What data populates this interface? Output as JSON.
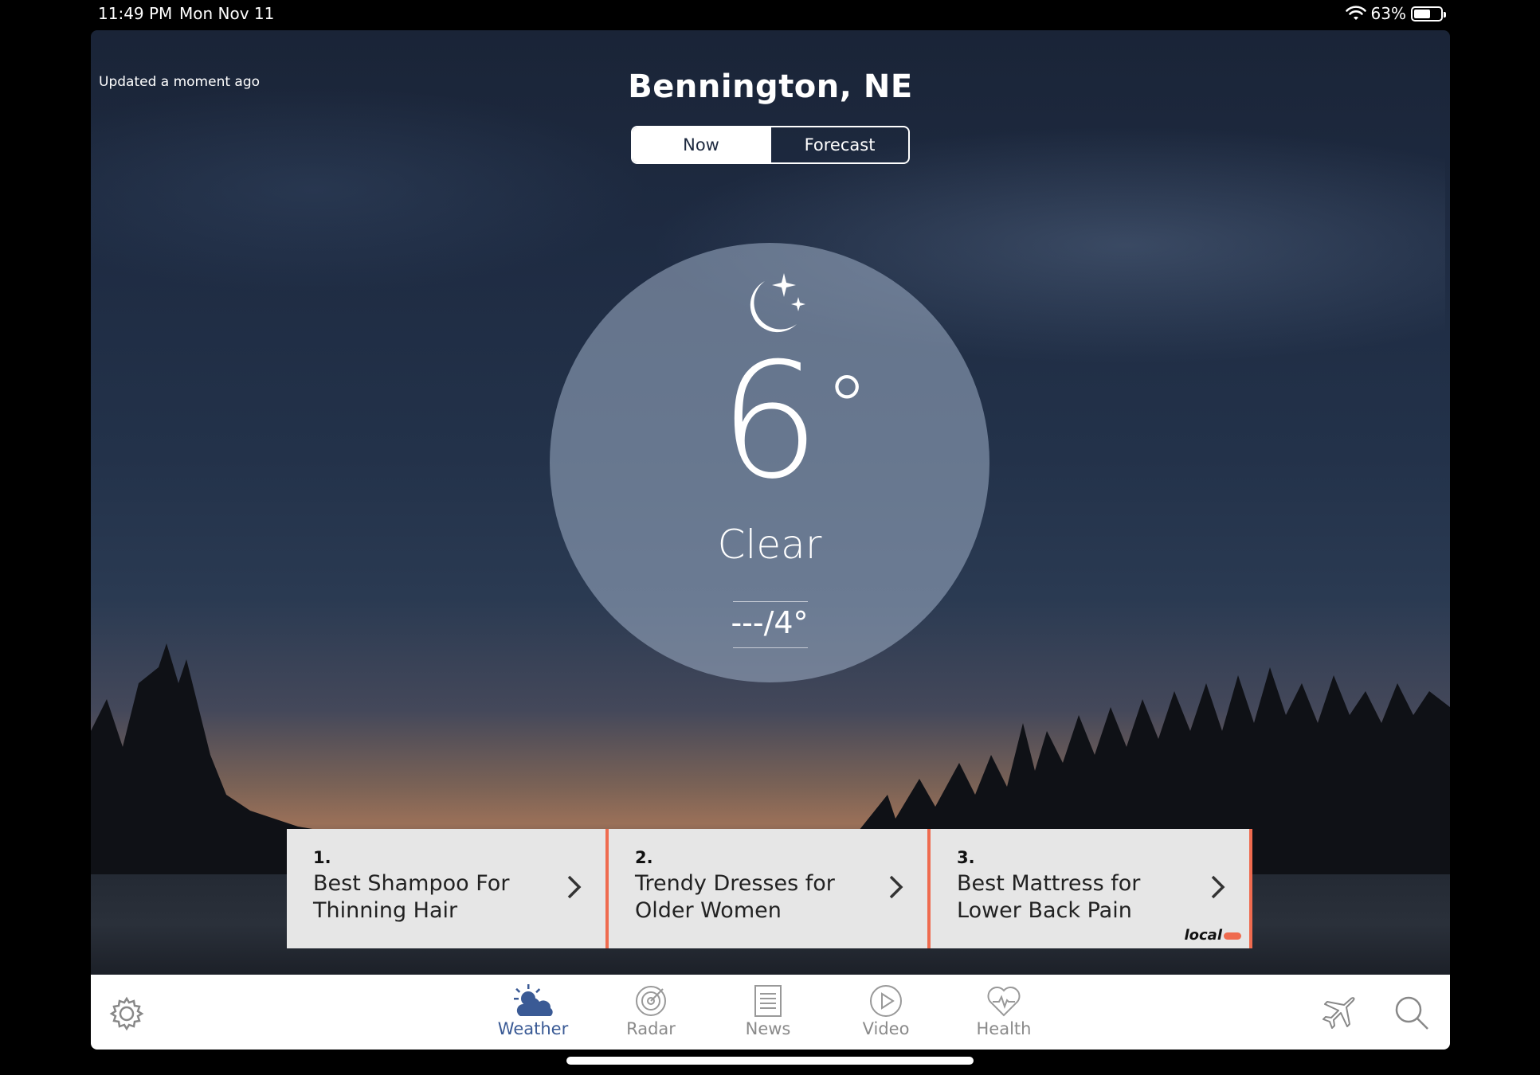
{
  "status_bar": {
    "time": "11:49 PM",
    "date": "Mon Nov 11",
    "battery": "63%"
  },
  "header": {
    "updated": "Updated a moment ago",
    "city": "Bennington, NE",
    "tabs": [
      {
        "label": "Now",
        "active": true
      },
      {
        "label": "Forecast",
        "active": false
      }
    ]
  },
  "current": {
    "icon": "moon-stars-icon",
    "temperature": "6",
    "degree_symbol": "°",
    "condition": "Clear",
    "hi_lo": "---/4°"
  },
  "ads": [
    {
      "number": "1.",
      "title": "Best Shampoo For Thinning Hair"
    },
    {
      "number": "2.",
      "title": "Trendy Dresses for Older Women"
    },
    {
      "number": "3.",
      "title": "Best Mattress for Lower Back Pain"
    }
  ],
  "ad_logo": "local",
  "tabbar": {
    "items": [
      {
        "label": "Weather",
        "icon": "weather-icon",
        "active": true
      },
      {
        "label": "Radar",
        "icon": "radar-icon",
        "active": false
      },
      {
        "label": "News",
        "icon": "news-icon",
        "active": false
      },
      {
        "label": "Video",
        "icon": "video-icon",
        "active": false
      },
      {
        "label": "Health",
        "icon": "health-icon",
        "active": false
      }
    ]
  },
  "colors": {
    "accent_active": "#3a5a95",
    "ad_divider": "#ef6b4f",
    "inactive": "#8a8a8a"
  }
}
